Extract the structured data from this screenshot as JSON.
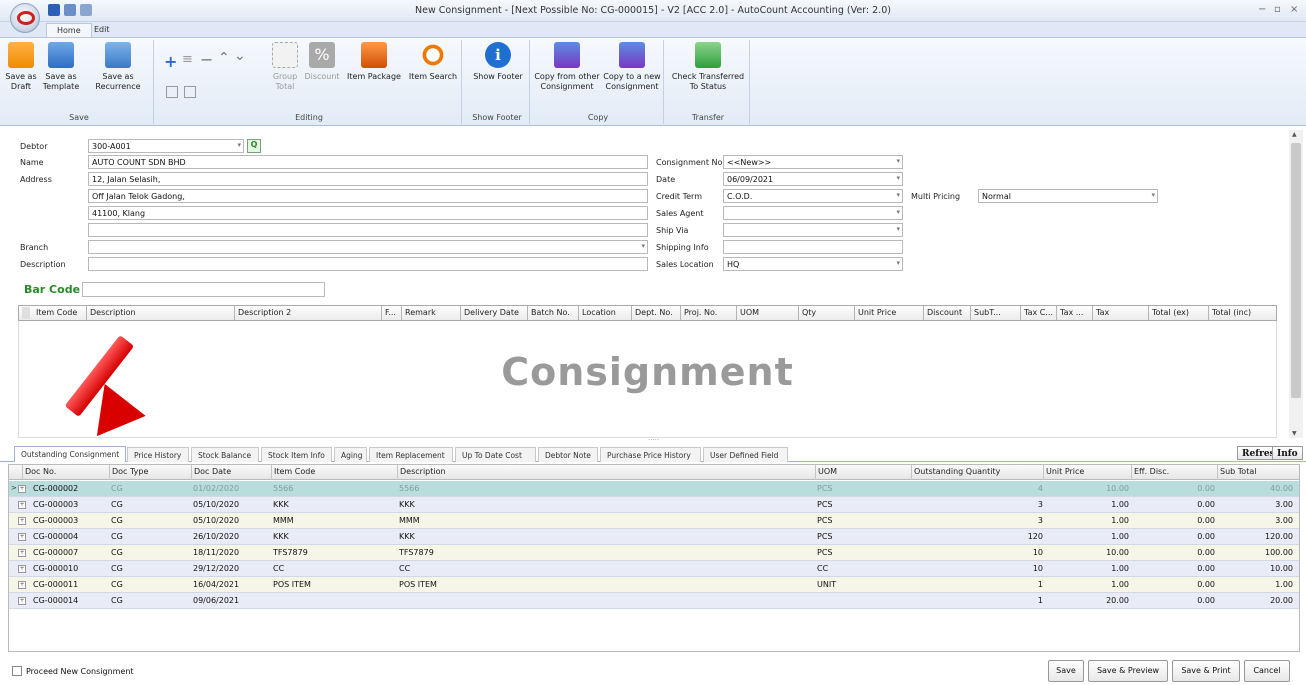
{
  "window": {
    "title": "New Consignment - [Next Possible No: CG-000015] - V2 [ACC 2.0] - AutoCount Accounting (Ver: 2.0)",
    "controls": [
      "−",
      "▫",
      "×"
    ]
  },
  "ribbon": {
    "tabs": [
      "Home",
      "Edit"
    ],
    "groups": {
      "save": "Save",
      "editing": "Editing",
      "show_footer": "Show Footer",
      "copy": "Copy",
      "transfer": "Transfer"
    },
    "buttons": {
      "save_draft": "Save as\nDraft",
      "save_template": "Save as\nTemplate",
      "save_recurrence": "Save as\nRecurrence",
      "group_total": "Group\nTotal",
      "discount": "Discount",
      "item_package": "Item Package",
      "item_search": "Item Search",
      "show_footer": "Show Footer",
      "copy_from": "Copy from other\nConsignment",
      "copy_to": "Copy to a new\nConsignment",
      "check_transferred": "Check Transferred\nTo Status"
    }
  },
  "form": {
    "debtor_label": "Debtor",
    "debtor_value": "300-A001",
    "name_label": "Name",
    "name_value": "AUTO COUNT SDN BHD",
    "address_label": "Address",
    "address_lines": [
      "12, Jalan Selasih,",
      "Off Jalan Telok Gadong,",
      "41100, Klang",
      ""
    ],
    "branch_label": "Branch",
    "branch_value": "",
    "description_label": "Description",
    "description_value": "",
    "barcode_label": "Bar Code",
    "barcode_value": "",
    "consignment_no_label": "Consignment No",
    "consignment_no_value": "<<New>>",
    "date_label": "Date",
    "date_value": "06/09/2021",
    "credit_term_label": "Credit Term",
    "credit_term_value": "C.O.D.",
    "sales_agent_label": "Sales Agent",
    "sales_agent_value": "",
    "ship_via_label": "Ship Via",
    "ship_via_value": "",
    "shipping_info_label": "Shipping Info",
    "shipping_info_value": "",
    "sales_location_label": "Sales Location",
    "sales_location_value": "HQ",
    "multi_pricing_label": "Multi Pricing",
    "multi_pricing_value": "Normal"
  },
  "detail_grid": {
    "columns": [
      "Item Code",
      "Description",
      "Description 2",
      "F...",
      "Remark",
      "Delivery Date",
      "Batch No.",
      "Location",
      "Dept. No.",
      "Proj. No.",
      "UOM",
      "Qty",
      "Unit Price",
      "Discount",
      "SubT...",
      "Tax C...",
      "Tax ...",
      "Tax",
      "Total (ex)",
      "Total (inc)"
    ],
    "watermark": "Consignment",
    "resize_dots": "....."
  },
  "bottom_tabs": [
    "Outstanding Consignment",
    "Price History",
    "Stock Balance",
    "Stock Item Info",
    "Aging",
    "Item Replacement",
    "Up To Date Cost",
    "Debtor Note",
    "Purchase Price History",
    "User Defined Field"
  ],
  "refresh_label": "Refresh",
  "info_label": "Info",
  "outstanding": {
    "columns": [
      "Doc No.",
      "Doc Type",
      "Doc Date",
      "Item Code",
      "Description",
      "UOM",
      "Outstanding Quantity",
      "Unit Price",
      "Eff. Disc.",
      "Sub Total"
    ],
    "rows": [
      [
        "CG-000002",
        "CG",
        "01/02/2020",
        "5566",
        "5566",
        "PCS",
        "4",
        "10.00",
        "0.00",
        "40.00"
      ],
      [
        "CG-000003",
        "CG",
        "05/10/2020",
        "KKK",
        "KKK",
        "PCS",
        "3",
        "1.00",
        "0.00",
        "3.00"
      ],
      [
        "CG-000003",
        "CG",
        "05/10/2020",
        "MMM",
        "MMM",
        "PCS",
        "3",
        "1.00",
        "0.00",
        "3.00"
      ],
      [
        "CG-000004",
        "CG",
        "26/10/2020",
        "KKK",
        "KKK",
        "PCS",
        "120",
        "1.00",
        "0.00",
        "120.00"
      ],
      [
        "CG-000007",
        "CG",
        "18/11/2020",
        "TFS7879",
        "TFS7879",
        "PCS",
        "10",
        "10.00",
        "0.00",
        "100.00"
      ],
      [
        "CG-000010",
        "CG",
        "29/12/2020",
        "CC",
        "CC",
        "CC",
        "10",
        "1.00",
        "0.00",
        "10.00"
      ],
      [
        "CG-000011",
        "CG",
        "16/04/2021",
        "POS ITEM",
        "POS ITEM",
        "UNIT",
        "1",
        "1.00",
        "0.00",
        "1.00"
      ],
      [
        "CG-000014",
        "CG",
        "09/06/2021",
        "",
        "",
        "",
        "1",
        "20.00",
        "0.00",
        "20.00"
      ]
    ]
  },
  "footer": {
    "proceed_label": "Proceed New Consignment",
    "save": "Save",
    "save_preview": "Save & Preview",
    "save_print": "Save & Print",
    "cancel": "Cancel"
  },
  "colors": {
    "ribbon_bg": "#e2ebf6",
    "row_selected": "#b9dcdc",
    "row_alt_even": "#e9ecf6",
    "row_alt_odd": "#f6f6e8",
    "barcode_green": "#2a8a2a",
    "arrow_red": "#d90000"
  }
}
